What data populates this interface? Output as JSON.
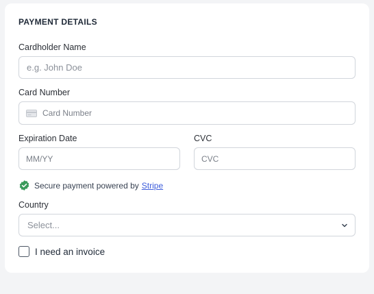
{
  "section_title": "PAYMENT DETAILS",
  "cardholder": {
    "label": "Cardholder Name",
    "placeholder": "e.g. John Doe"
  },
  "card_number": {
    "label": "Card Number",
    "placeholder": "Card Number",
    "icon": "credit-card-icon"
  },
  "expiration": {
    "label": "Expiration Date",
    "placeholder": "MM/YY"
  },
  "cvc": {
    "label": "CVC",
    "placeholder": "CVC"
  },
  "secure_notice": {
    "text": "Secure payment powered by",
    "link_text": "Stripe",
    "icon": "verified-check-icon",
    "icon_color": "#3a9a5b"
  },
  "country": {
    "label": "Country",
    "selected": "Select..."
  },
  "invoice": {
    "label": "I need an invoice",
    "checked": false
  },
  "colors": {
    "background": "#f3f4f6",
    "card": "#ffffff",
    "border": "#d1d5db",
    "link": "#3b5bdb"
  }
}
